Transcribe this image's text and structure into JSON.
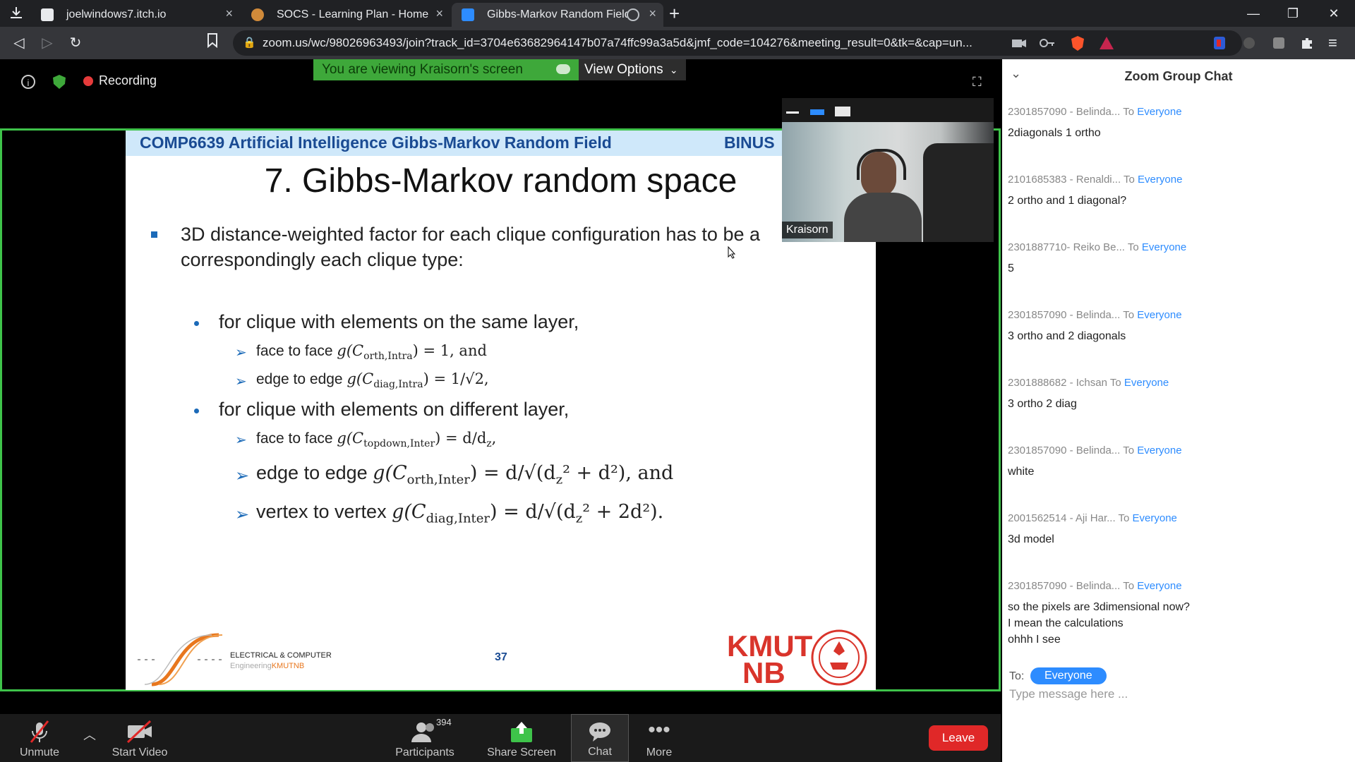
{
  "browser": {
    "tabs": [
      {
        "title": "joelwindows7.itch.io"
      },
      {
        "title": "SOCS - Learning Plan - Home"
      },
      {
        "title": "Gibbs-Markov Random Field"
      }
    ],
    "url": "zoom.us/wc/98026963493/join?track_id=3704e63682964147b07a74ffc99a3a5d&jmf_code=104276&meeting_result=0&tk=&cap=un..."
  },
  "meeting": {
    "recording_label": "Recording",
    "viewing_banner": "You are viewing Kraisorn's screen",
    "view_options": "View Options"
  },
  "slide": {
    "header_title": "COMP6639 Artificial Intelligence Gibbs-Markov Random Field",
    "header_brand": "BINUS",
    "title": "7. Gibbs-Markov random space",
    "main_bullet_line1": "3D distance-weighted factor for each clique configuration has to be a",
    "main_bullet_line2": "correspondingly each clique type:",
    "sub1": "for clique with elements on the same layer,",
    "sub1_a_text": "face to face",
    "sub1_a_math": "g(C",
    "sub1_a_sub": "orth,Intra",
    "sub1_a_rest": ") = 1, and",
    "sub1_b_text": "edge to edge",
    "sub1_b_math": "g(C",
    "sub1_b_sub": "diag,Intra",
    "sub1_b_rest": ") = 1/√2,",
    "sub2": "for clique with elements on different layer,",
    "sub2_a_text": "face to face",
    "sub2_a_math": "g(C",
    "sub2_a_sub": "topdown,Inter",
    "sub2_a_rest": ") = d/d",
    "sub2_a_tail": "z",
    "sub2_a_end": ",",
    "sub2_b_text": "edge to edge",
    "sub2_b_math": "g(C",
    "sub2_b_sub": "orth,Inter",
    "sub2_b_rest": ") = d/√(d",
    "sub2_b_tail": "z",
    "sub2_b_end": "² + d²), and",
    "sub2_c_text": "vertex to vertex",
    "sub2_c_math": "g(C",
    "sub2_c_sub": "diag,Inter",
    "sub2_c_rest": ") = d/√(d",
    "sub2_c_tail": "z",
    "sub2_c_end": "² + 2d²).",
    "footer_dept_line1": "ELECTRICAL & COMPUTER",
    "footer_dept_line2a": "Engineering",
    "footer_dept_line2b": "KMUTNB",
    "page_number": "37",
    "logo_line1": "KMUT",
    "logo_line2": "NB"
  },
  "video": {
    "participant_name": "Kraisorn"
  },
  "chat": {
    "title": "Zoom Group Chat",
    "messages": [
      {
        "sender": "2301857090 - Belinda...",
        "to": "To",
        "target": "Everyone",
        "body": "2diagonals 1 ortho"
      },
      {
        "sender": "2101685383 - Renaldi...",
        "to": "To",
        "target": "Everyone",
        "body": "2 ortho and 1 diagonal?"
      },
      {
        "sender": "2301887710- Reiko Be...",
        "to": "To",
        "target": "Everyone",
        "body": "5"
      },
      {
        "sender": "2301857090 - Belinda...",
        "to": "To",
        "target": "Everyone",
        "body": "3 ortho and 2 diagonals"
      },
      {
        "sender": "2301888682 - Ichsan",
        "to": "To",
        "target": "Everyone",
        "body": "3 ortho 2 diag"
      },
      {
        "sender": "2301857090 - Belinda...",
        "to": "To",
        "target": "Everyone",
        "body": "white"
      },
      {
        "sender": "2001562514 - Aji Har...",
        "to": "To",
        "target": "Everyone",
        "body": "3d model"
      },
      {
        "sender": "2301857090 - Belinda...",
        "to": "To",
        "target": "Everyone",
        "body": "so the pixels are 3dimensional now?\nI mean the calculations\nohhh I see"
      }
    ],
    "to_label": "To:",
    "to_target": "Everyone",
    "input_placeholder": "Type message here ..."
  },
  "controls": {
    "unmute": "Unmute",
    "start_video": "Start Video",
    "participants": "Participants",
    "participants_count": "394",
    "share_screen": "Share Screen",
    "chat": "Chat",
    "more": "More",
    "leave": "Leave"
  },
  "colors": {
    "share_border": "#3ec34a",
    "chat_accent": "#2d8cff",
    "leave": "#e02828"
  }
}
